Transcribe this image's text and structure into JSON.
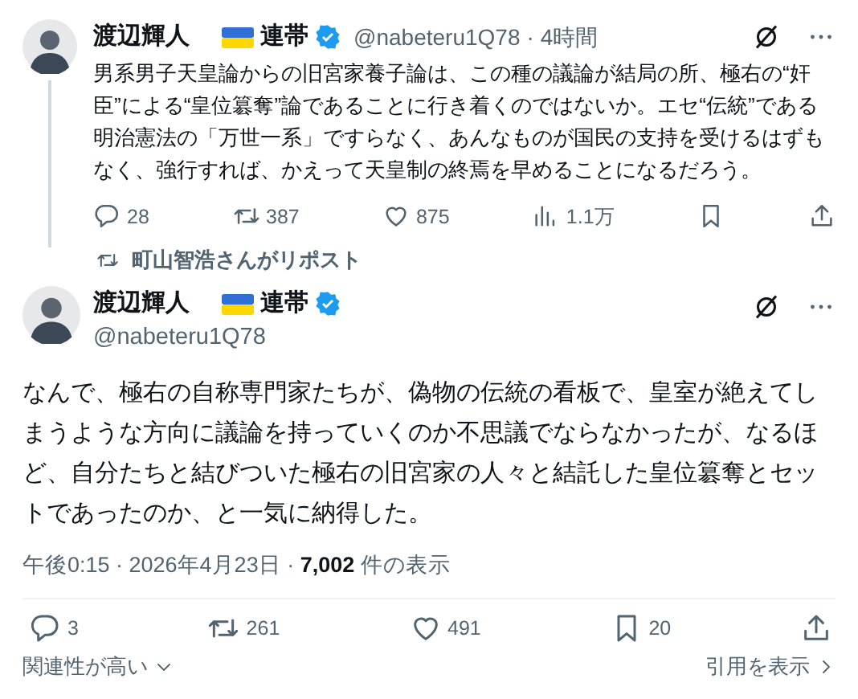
{
  "parent_post": {
    "author": "渡辺輝人",
    "flag_label": "連帯",
    "verified": true,
    "handle": "@nabeteru1Q78",
    "separator": "·",
    "time": "4時間",
    "text": "男系男子天皇論からの旧宮家養子論は、この種の議論が結局の所、極右の“奸臣”による“皇位簒奪”論であることに行き着くのではないか。エセ“伝統”である明治憲法の「万世一系」ですらなく、あんなものが国民の支持を受けるはずもなく、強行すれば、かえって天皇制の終焉を早めることになるだろう。",
    "actions": [
      {
        "kind": "reply",
        "count": "28"
      },
      {
        "kind": "repost",
        "count": "387"
      },
      {
        "kind": "like",
        "count": "875"
      },
      {
        "kind": "views",
        "count": "1.1万"
      },
      {
        "kind": "bookmark"
      },
      {
        "kind": "share"
      }
    ]
  },
  "repost_banner": "町山智浩さんがリポスト",
  "main_post": {
    "author": "渡辺輝人",
    "flag_label": "連帯",
    "verified": true,
    "handle": "@nabeteru1Q78",
    "text": "なんで、極右の自称専門家たちが、偽物の伝統の看板で、皇室が絶えてしまうような方向に議論を持っていくのか不思議でならなかったが、なるほど、自分たちと結びついた極右の旧宮家の人々と結託した皇位簒奪とセットであったのか、と一気に納得した。",
    "timestamp": "午後0:15 · 2026年4月23日 · ",
    "views": "7,002",
    "views_label": " 件の表示",
    "actions": [
      {
        "kind": "reply",
        "count": "3"
      },
      {
        "kind": "repost",
        "count": "261"
      },
      {
        "kind": "like",
        "count": "491"
      },
      {
        "kind": "bookmark",
        "count": "20"
      },
      {
        "kind": "share"
      }
    ]
  },
  "footer": {
    "sort": "関連性が高い",
    "quotes": "引用を表示"
  }
}
